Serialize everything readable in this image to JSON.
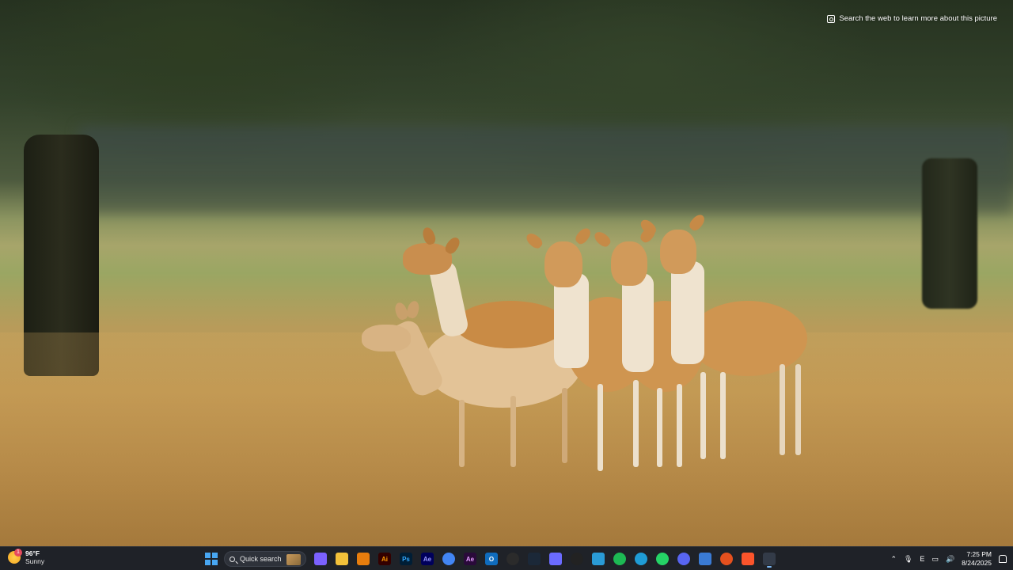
{
  "desktop": {
    "visual_search_label": "Search the web to learn more about this picture"
  },
  "weather": {
    "temperature": "96°F",
    "condition": "Sunny",
    "badge": "1"
  },
  "taskbar": {
    "search_label": "Quick search",
    "apps": [
      {
        "name": "copilot-icon",
        "glyph": "",
        "color": "#7b61ff"
      },
      {
        "name": "file-explorer-icon",
        "glyph": "",
        "color": "#f3c13a"
      },
      {
        "name": "blender-icon",
        "glyph": "",
        "color": "#e87d0d"
      },
      {
        "name": "illustrator-icon",
        "glyph": "Ai",
        "color": "#330000",
        "fg": "#ff9a00"
      },
      {
        "name": "photoshop-icon",
        "glyph": "Ps",
        "color": "#001e36",
        "fg": "#31a8ff"
      },
      {
        "name": "after-effects-icon",
        "glyph": "Ae",
        "color": "#00005b",
        "fg": "#9999ff"
      },
      {
        "name": "chrome-icon",
        "glyph": "",
        "color": "#4285f4"
      },
      {
        "name": "premiere-icon",
        "glyph": "Ae",
        "color": "#2a0a3a",
        "fg": "#e39cff"
      },
      {
        "name": "outlook-icon",
        "glyph": "O",
        "color": "#0f6cbd"
      },
      {
        "name": "chatgpt-icon",
        "glyph": "",
        "color": "#2b2b2b"
      },
      {
        "name": "steam-icon",
        "glyph": "",
        "color": "#1b2838"
      },
      {
        "name": "designer-icon",
        "glyph": "",
        "color": "#6b6bff"
      },
      {
        "name": "davinci-icon",
        "glyph": "",
        "color": "#222222"
      },
      {
        "name": "image-viewer-icon",
        "glyph": "",
        "color": "#2a9bd6"
      },
      {
        "name": "spotify-icon",
        "glyph": "",
        "color": "#1db954"
      },
      {
        "name": "edge-icon",
        "glyph": "",
        "color": "#1f9cd6"
      },
      {
        "name": "whatsapp-icon",
        "glyph": "",
        "color": "#25d366"
      },
      {
        "name": "discord-icon",
        "glyph": "",
        "color": "#5865f2"
      },
      {
        "name": "settings-window-icon",
        "glyph": "",
        "color": "#3a7bd5"
      },
      {
        "name": "orange-app-icon",
        "glyph": "",
        "color": "#e5501e"
      },
      {
        "name": "brave-icon",
        "glyph": "",
        "color": "#fb542b"
      },
      {
        "name": "snipping-tool-icon",
        "glyph": "",
        "color": "#333b48"
      }
    ]
  },
  "tray": {
    "keyboard_layout": "E",
    "time": "7:25 PM",
    "date": "8/24/2025"
  }
}
